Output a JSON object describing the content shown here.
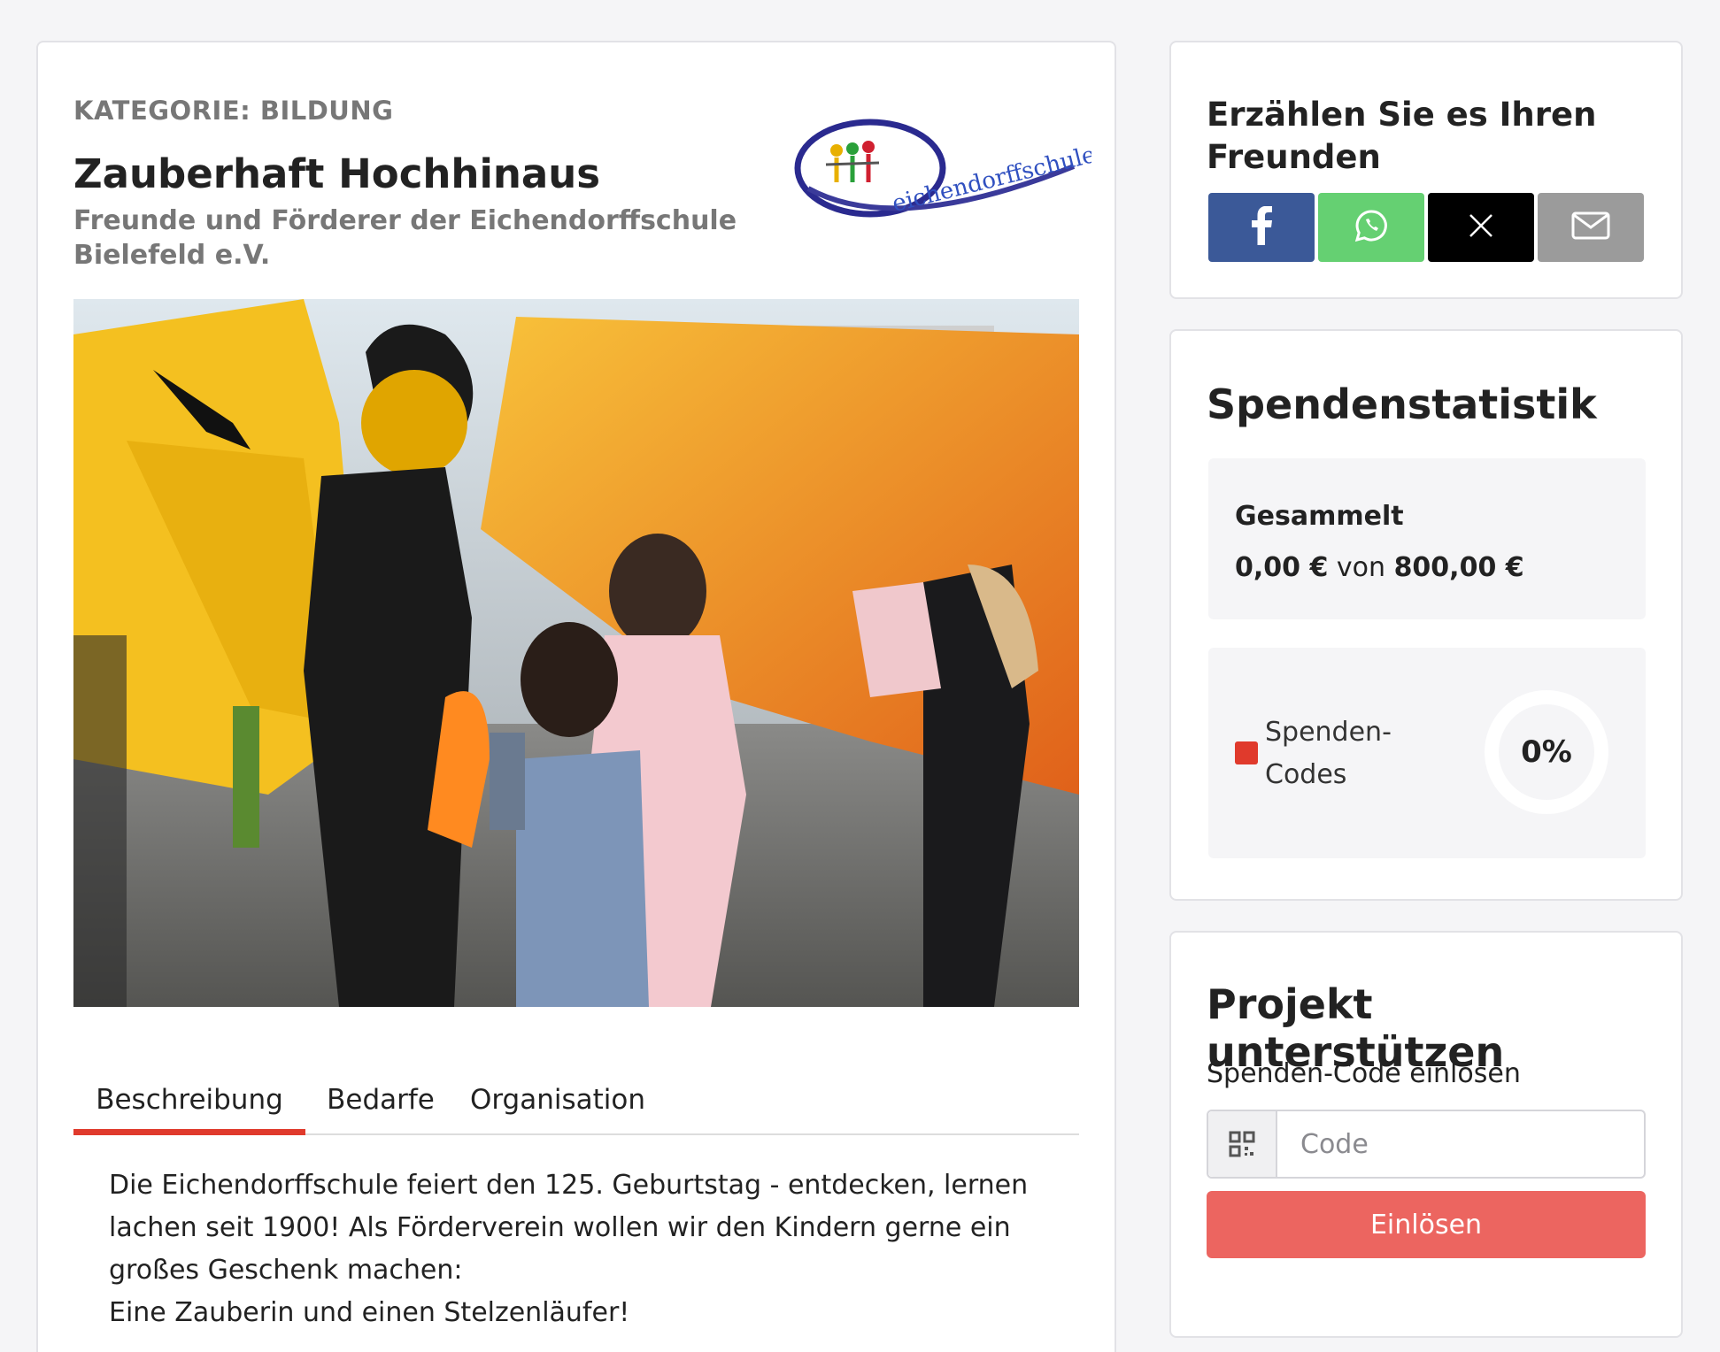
{
  "project": {
    "category": "KATEGORIE: BILDUNG",
    "title": "Zauberhaft Hochhinaus",
    "organization": "Freunde und Förderer der Eichendorffschule Bielefeld e.V.",
    "logo_text": "eichendorffschule"
  },
  "tabs": [
    {
      "label": "Beschreibung",
      "active": true
    },
    {
      "label": "Bedarfe",
      "active": false
    },
    {
      "label": "Organisation",
      "active": false
    }
  ],
  "description": {
    "line1": "Die Eichendorffschule feiert den 125. Geburtstag - entdecken, lernen lachen seit 1900! Als Förderverein wollen wir den Kindern gerne ein großes Geschenk machen:",
    "line2": "Eine Zauberin und einen Stelzenläufer!"
  },
  "share": {
    "heading": "Erzählen Sie es Ihren Freunden",
    "buttons": [
      {
        "icon": "facebook-icon",
        "color": "#3b5998"
      },
      {
        "icon": "whatsapp-icon",
        "color": "#65d072"
      },
      {
        "icon": "x-icon",
        "color": "#000000"
      },
      {
        "icon": "mail-icon",
        "color": "#9b9b9b"
      }
    ]
  },
  "stats": {
    "heading": "Spendenstatistik",
    "collected_label": "Gesammelt",
    "collected_amount": "0,00 €",
    "of_word": "von",
    "goal_amount": "800,00 €",
    "legend_label": "Spenden-Codes",
    "legend_color": "#e03a2c",
    "percent_text": "0%",
    "percent_value": 0
  },
  "support": {
    "heading": "Projekt unterstützen",
    "redeem_label": "Spenden-Code einlösen",
    "code_placeholder": "Code",
    "code_value": "",
    "redeem_button": "Einlösen",
    "button_color": "#ec6560"
  }
}
